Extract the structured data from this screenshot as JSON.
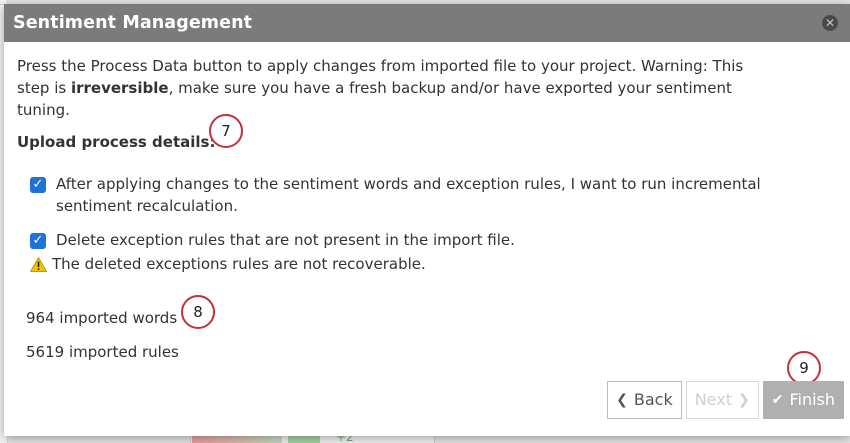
{
  "dialog": {
    "title": "Sentiment Management",
    "close_icon": "close-icon",
    "intro_prefix": "Press the Process Data button to apply changes from imported file to your project. Warning: This step is ",
    "intro_bold": "irreversible",
    "intro_suffix": ", make sure you have a fresh backup and/or have exported your sentiment tuning.",
    "section_title": "Upload process details:",
    "options": [
      {
        "label": "After applying changes to the sentiment words and exception rules, I want to run incremental sentiment recalculation.",
        "checked": true
      },
      {
        "label": "Delete exception rules that are not present in the import file.",
        "checked": true
      }
    ],
    "warning_text": "The deleted exceptions rules are not recoverable.",
    "imported_words": "964 imported words",
    "imported_rules": "5619 imported rules",
    "buttons": {
      "back": "Back",
      "next": "Next",
      "finish": "Finish"
    },
    "step_markers": [
      "7",
      "8",
      "9"
    ]
  },
  "background": {
    "peek_text": "+2"
  },
  "colors": {
    "header_bg": "#7b7b7b",
    "checkbox_blue": "#1e73d6",
    "marker_red": "#c0323a",
    "warning_yellow": "#f2c200"
  }
}
